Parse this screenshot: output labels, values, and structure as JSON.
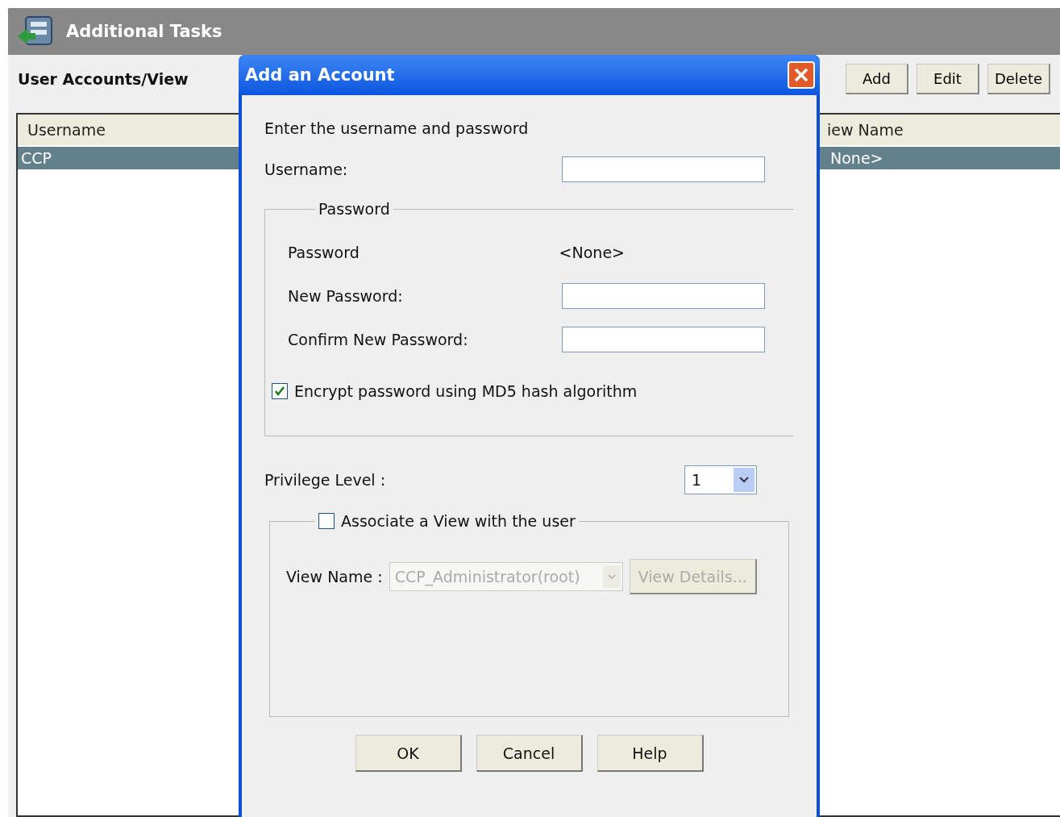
{
  "window": {
    "title": "Additional Tasks"
  },
  "section_title": "User Accounts/View",
  "toolbar_buttons": [
    "Add",
    "Edit",
    "Delete"
  ],
  "table": {
    "columns": [
      "Username",
      "iew Name"
    ],
    "rows": [
      {
        "cells": [
          "CCP",
          "None>"
        ],
        "selected": true
      }
    ]
  },
  "dialog": {
    "title": "Add an Account",
    "instruction": "Enter the username and password",
    "username_label": "Username:",
    "password_group": {
      "legend": "Password",
      "current_label": "Password",
      "current_value": "<None>",
      "new_label": "New Password:",
      "confirm_label": "Confirm New Password:",
      "encrypt": {
        "label": "Encrypt password using MD5 hash algorithm",
        "checked": true
      }
    },
    "privilege": {
      "label": "Privilege Level :",
      "value": "1"
    },
    "view_group": {
      "associate": {
        "label": "Associate a View with the user",
        "checked": false
      },
      "view_label": "View Name :",
      "view_value": "CCP_Administrator(root)",
      "details_button": "View Details...",
      "disabled": true
    },
    "buttons": [
      "OK",
      "Cancel",
      "Help"
    ]
  }
}
